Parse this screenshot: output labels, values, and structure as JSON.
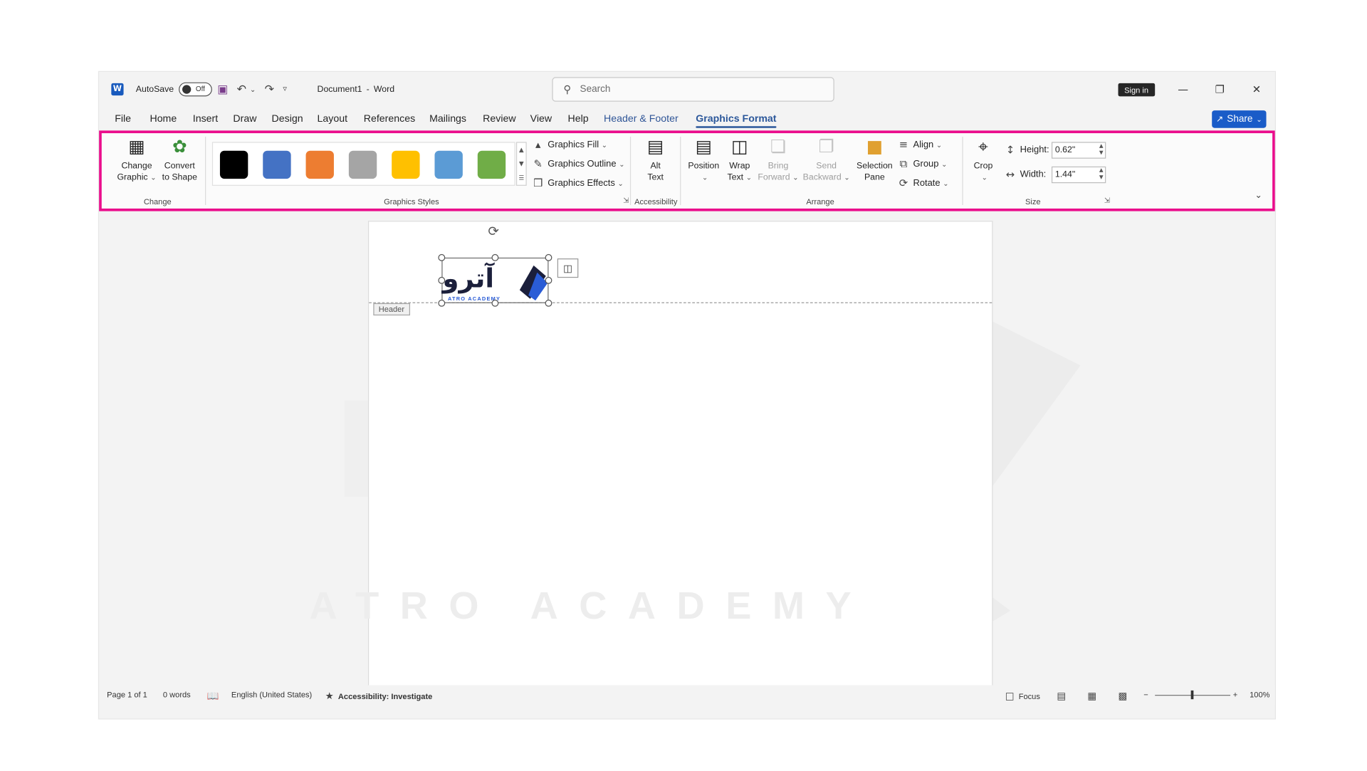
{
  "titlebar": {
    "autosave_label": "AutoSave",
    "autosave_state": "Off",
    "document_name": "Document1",
    "separator": "-",
    "app_name": "Word",
    "search_placeholder": "Search",
    "sign_in": "Sign in"
  },
  "menu": {
    "tabs": [
      "File",
      "Home",
      "Insert",
      "Draw",
      "Design",
      "Layout",
      "References",
      "Mailings",
      "Review",
      "View",
      "Help"
    ],
    "context_tabs": [
      "Header & Footer",
      "Graphics Format"
    ],
    "share": "Share"
  },
  "ribbon": {
    "change": {
      "change_graphic_line1": "Change",
      "change_graphic_line2": "Graphic",
      "convert_line1": "Convert",
      "convert_line2": "to Shape",
      "label": "Change"
    },
    "styles": {
      "swatches": [
        "#000000",
        "#4472c4",
        "#ed7d31",
        "#a5a5a5",
        "#ffc000",
        "#5b9bd5",
        "#70ad47"
      ],
      "fill": "Graphics Fill",
      "outline": "Graphics Outline",
      "effects": "Graphics Effects",
      "label": "Graphics Styles"
    },
    "accessibility": {
      "alt_line1": "Alt",
      "alt_line2": "Text",
      "label": "Accessibility"
    },
    "arrange": {
      "position": "Position",
      "wrap_line1": "Wrap",
      "wrap_line2": "Text",
      "bring_line1": "Bring",
      "bring_line2": "Forward",
      "send_line1": "Send",
      "send_line2": "Backward",
      "selection_line1": "Selection",
      "selection_line2": "Pane",
      "align": "Align",
      "group": "Group",
      "rotate": "Rotate",
      "label": "Arrange"
    },
    "size": {
      "crop": "Crop",
      "height_label": "Height:",
      "height_value": "0.62\"",
      "width_label": "Width:",
      "width_value": "1.44\"",
      "label": "Size"
    }
  },
  "document": {
    "header_tag": "Header",
    "logo_text": "آترو",
    "logo_subtext": "ATRO ACADEMY",
    "watermark_text": "ATRO ACADEMY"
  },
  "status": {
    "page": "Page 1 of 1",
    "words": "0 words",
    "language": "English (United States)",
    "accessibility": "Accessibility: Investigate",
    "focus": "Focus",
    "zoom": "100%"
  },
  "colors": {
    "ribbon_highlight": "#ea0d8c",
    "accent": "#2b579a",
    "share": "#1a5cc8"
  }
}
